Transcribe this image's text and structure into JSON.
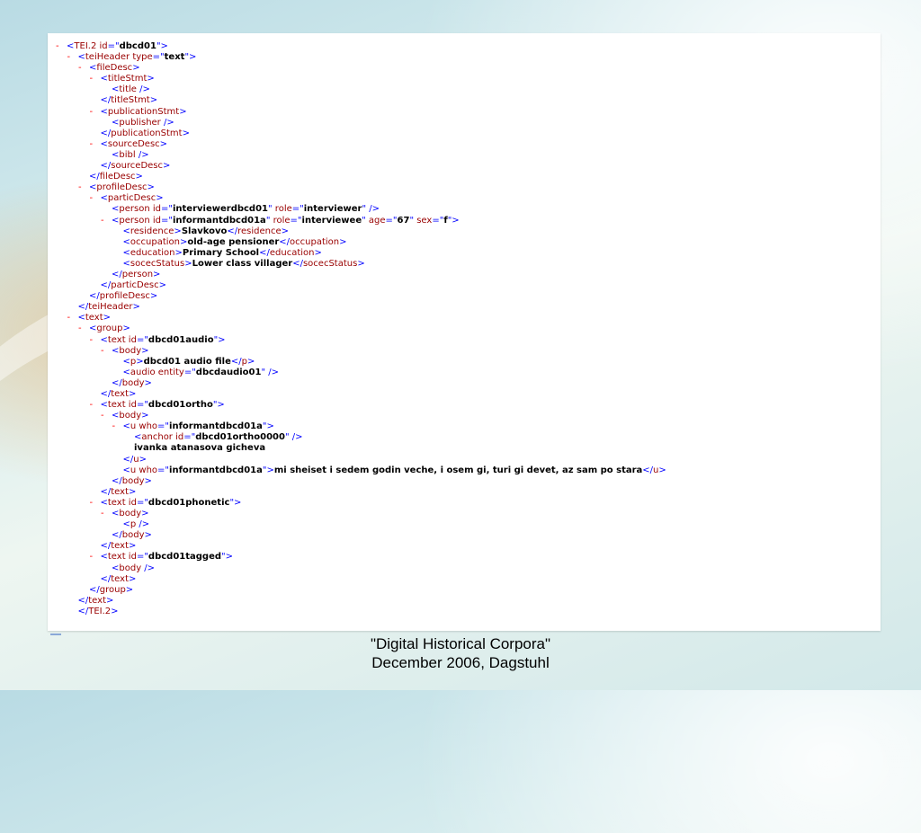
{
  "xml_lines": [
    {
      "indent": 0,
      "marker": "-",
      "html": "<span class='b'>&lt;</span><span class='t'>TEI.2 id</span><span class='b'>=\"</span><span class='v'>dbcd01</span><span class='b'>\"&gt;</span>"
    },
    {
      "indent": 1,
      "marker": "-",
      "html": "<span class='b'>&lt;</span><span class='t'>teiHeader type</span><span class='b'>=\"</span><span class='v'>text</span><span class='b'>\"&gt;</span>"
    },
    {
      "indent": 2,
      "marker": "-",
      "html": "<span class='b'>&lt;</span><span class='t'>fileDesc</span><span class='b'>&gt;</span>"
    },
    {
      "indent": 3,
      "marker": "-",
      "html": "<span class='b'>&lt;</span><span class='t'>titleStmt</span><span class='b'>&gt;</span>"
    },
    {
      "indent": 4,
      "marker": "",
      "html": "<span class='b'>&lt;</span><span class='t'>title</span><span class='b'> /&gt;</span>"
    },
    {
      "indent": 3,
      "marker": "",
      "html": "<span class='b'>&lt;/</span><span class='t'>titleStmt</span><span class='b'>&gt;</span>"
    },
    {
      "indent": 3,
      "marker": "-",
      "html": "<span class='b'>&lt;</span><span class='t'>publicationStmt</span><span class='b'>&gt;</span>"
    },
    {
      "indent": 4,
      "marker": "",
      "html": "<span class='b'>&lt;</span><span class='t'>publisher</span><span class='b'> /&gt;</span>"
    },
    {
      "indent": 3,
      "marker": "",
      "html": "<span class='b'>&lt;/</span><span class='t'>publicationStmt</span><span class='b'>&gt;</span>"
    },
    {
      "indent": 3,
      "marker": "-",
      "html": "<span class='b'>&lt;</span><span class='t'>sourceDesc</span><span class='b'>&gt;</span>"
    },
    {
      "indent": 4,
      "marker": "",
      "html": "<span class='b'>&lt;</span><span class='t'>bibl</span><span class='b'> /&gt;</span>"
    },
    {
      "indent": 3,
      "marker": "",
      "html": "<span class='b'>&lt;/</span><span class='t'>sourceDesc</span><span class='b'>&gt;</span>"
    },
    {
      "indent": 2,
      "marker": "",
      "html": "<span class='b'>&lt;/</span><span class='t'>fileDesc</span><span class='b'>&gt;</span>"
    },
    {
      "indent": 2,
      "marker": "-",
      "html": "<span class='b'>&lt;</span><span class='t'>profileDesc</span><span class='b'>&gt;</span>"
    },
    {
      "indent": 3,
      "marker": "-",
      "html": "<span class='b'>&lt;</span><span class='t'>particDesc</span><span class='b'>&gt;</span>"
    },
    {
      "indent": 4,
      "marker": "",
      "html": "<span class='b'>&lt;</span><span class='t'>person id</span><span class='b'>=\"</span><span class='v'>interviewerdbcd01</span><span class='b'>\"</span><span class='a'> role</span><span class='b'>=\"</span><span class='v'>interviewer</span><span class='b'>\" /&gt;</span>"
    },
    {
      "indent": 4,
      "marker": "-",
      "html": "<span class='b'>&lt;</span><span class='t'>person id</span><span class='b'>=\"</span><span class='v'>informantdbcd01a</span><span class='b'>\"</span><span class='a'> role</span><span class='b'>=\"</span><span class='v'>interviewee</span><span class='b'>\"</span><span class='a'> age</span><span class='b'>=\"</span><span class='v'>67</span><span class='b'>\"</span><span class='a'> sex</span><span class='b'>=\"</span><span class='v'>f</span><span class='b'>\"&gt;</span>"
    },
    {
      "indent": 5,
      "marker": "",
      "html": "<span class='b'>&lt;</span><span class='t'>residence</span><span class='b'>&gt;</span><span class='x'>Slavkovo</span><span class='b'>&lt;/</span><span class='t'>residence</span><span class='b'>&gt;</span>"
    },
    {
      "indent": 5,
      "marker": "",
      "html": "<span class='b'>&lt;</span><span class='t'>occupation</span><span class='b'>&gt;</span><span class='x'>old-age pensioner</span><span class='b'>&lt;/</span><span class='t'>occupation</span><span class='b'>&gt;</span>"
    },
    {
      "indent": 5,
      "marker": "",
      "html": "<span class='b'>&lt;</span><span class='t'>education</span><span class='b'>&gt;</span><span class='x'>Primary School</span><span class='b'>&lt;/</span><span class='t'>education</span><span class='b'>&gt;</span>"
    },
    {
      "indent": 5,
      "marker": "",
      "html": "<span class='b'>&lt;</span><span class='t'>socecStatus</span><span class='b'>&gt;</span><span class='x'>Lower class villager</span><span class='b'>&lt;/</span><span class='t'>socecStatus</span><span class='b'>&gt;</span>"
    },
    {
      "indent": 4,
      "marker": "",
      "html": "<span class='b'>&lt;/</span><span class='t'>person</span><span class='b'>&gt;</span>"
    },
    {
      "indent": 3,
      "marker": "",
      "html": "<span class='b'>&lt;/</span><span class='t'>particDesc</span><span class='b'>&gt;</span>"
    },
    {
      "indent": 2,
      "marker": "",
      "html": "<span class='b'>&lt;/</span><span class='t'>profileDesc</span><span class='b'>&gt;</span>"
    },
    {
      "indent": 1,
      "marker": "",
      "html": "<span class='b'>&lt;/</span><span class='t'>teiHeader</span><span class='b'>&gt;</span>"
    },
    {
      "indent": 1,
      "marker": "-",
      "html": "<span class='b'>&lt;</span><span class='t'>text</span><span class='b'>&gt;</span>"
    },
    {
      "indent": 2,
      "marker": "-",
      "html": "<span class='b'>&lt;</span><span class='t'>group</span><span class='b'>&gt;</span>"
    },
    {
      "indent": 3,
      "marker": "-",
      "html": "<span class='b'>&lt;</span><span class='t'>text id</span><span class='b'>=\"</span><span class='v'>dbcd01audio</span><span class='b'>\"&gt;</span>"
    },
    {
      "indent": 4,
      "marker": "-",
      "html": "<span class='b'>&lt;</span><span class='t'>body</span><span class='b'>&gt;</span>"
    },
    {
      "indent": 5,
      "marker": "",
      "html": "<span class='b'>&lt;</span><span class='t'>p</span><span class='b'>&gt;</span><span class='x'>dbcd01 audio file</span><span class='b'>&lt;/</span><span class='t'>p</span><span class='b'>&gt;</span>"
    },
    {
      "indent": 5,
      "marker": "",
      "html": "<span class='b'>&lt;</span><span class='t'>audio entity</span><span class='b'>=\"</span><span class='v'>dbcdaudio01</span><span class='b'>\" /&gt;</span>"
    },
    {
      "indent": 4,
      "marker": "",
      "html": "<span class='b'>&lt;/</span><span class='t'>body</span><span class='b'>&gt;</span>"
    },
    {
      "indent": 3,
      "marker": "",
      "html": "<span class='b'>&lt;/</span><span class='t'>text</span><span class='b'>&gt;</span>"
    },
    {
      "indent": 3,
      "marker": "-",
      "html": "<span class='b'>&lt;</span><span class='t'>text id</span><span class='b'>=\"</span><span class='v'>dbcd01ortho</span><span class='b'>\"&gt;</span>"
    },
    {
      "indent": 4,
      "marker": "-",
      "html": "<span class='b'>&lt;</span><span class='t'>body</span><span class='b'>&gt;</span>"
    },
    {
      "indent": 5,
      "marker": "-",
      "html": "<span class='b'>&lt;</span><span class='t'>u who</span><span class='b'>=\"</span><span class='v'>informantdbcd01a</span><span class='b'>\"&gt;</span>"
    },
    {
      "indent": 6,
      "marker": "",
      "html": "<span class='b'>&lt;</span><span class='t'>anchor id</span><span class='b'>=\"</span><span class='v'>dbcd01ortho0000</span><span class='b'>\" /&gt;</span>"
    },
    {
      "indent": 6,
      "marker": "",
      "html": "<span class='x'>ivanka atanasova gicheva</span>"
    },
    {
      "indent": 5,
      "marker": "",
      "html": "<span class='b'>&lt;/</span><span class='t'>u</span><span class='b'>&gt;</span>"
    },
    {
      "indent": 5,
      "marker": "",
      "html": "<span class='b'>&lt;</span><span class='t'>u who</span><span class='b'>=\"</span><span class='v'>informantdbcd01a</span><span class='b'>\"&gt;</span><span class='x'>mi sheiset i sedem godin veche, i osem gi, turi gi devet, az sam po stara</span><span class='b'>&lt;/</span><span class='t'>u</span><span class='b'>&gt;</span>"
    },
    {
      "indent": 4,
      "marker": "",
      "html": "<span class='b'>&lt;/</span><span class='t'>body</span><span class='b'>&gt;</span>"
    },
    {
      "indent": 3,
      "marker": "",
      "html": "<span class='b'>&lt;/</span><span class='t'>text</span><span class='b'>&gt;</span>"
    },
    {
      "indent": 3,
      "marker": "-",
      "html": "<span class='b'>&lt;</span><span class='t'>text id</span><span class='b'>=\"</span><span class='v'>dbcd01phonetic</span><span class='b'>\"&gt;</span>"
    },
    {
      "indent": 4,
      "marker": "-",
      "html": "<span class='b'>&lt;</span><span class='t'>body</span><span class='b'>&gt;</span>"
    },
    {
      "indent": 5,
      "marker": "",
      "html": "<span class='b'>&lt;</span><span class='t'>p</span><span class='b'> /&gt;</span>"
    },
    {
      "indent": 4,
      "marker": "",
      "html": "<span class='b'>&lt;/</span><span class='t'>body</span><span class='b'>&gt;</span>"
    },
    {
      "indent": 3,
      "marker": "",
      "html": "<span class='b'>&lt;/</span><span class='t'>text</span><span class='b'>&gt;</span>"
    },
    {
      "indent": 3,
      "marker": "-",
      "html": "<span class='b'>&lt;</span><span class='t'>text id</span><span class='b'>=\"</span><span class='v'>dbcd01tagged</span><span class='b'>\"&gt;</span>"
    },
    {
      "indent": 4,
      "marker": "",
      "html": "<span class='b'>&lt;</span><span class='t'>body</span><span class='b'> /&gt;</span>"
    },
    {
      "indent": 3,
      "marker": "",
      "html": "<span class='b'>&lt;/</span><span class='t'>text</span><span class='b'>&gt;</span>"
    },
    {
      "indent": 2,
      "marker": "",
      "html": "<span class='b'>&lt;/</span><span class='t'>group</span><span class='b'>&gt;</span>"
    },
    {
      "indent": 1,
      "marker": "",
      "html": "<span class='b'>&lt;/</span><span class='t'>text</span><span class='b'>&gt;</span>"
    },
    {
      "indent": 1,
      "marker": "",
      "html": "<span class='b'>&lt;/</span><span class='t'>TEI.2</span><span class='b'>&gt;</span>"
    }
  ],
  "footer": {
    "line1": "\"Digital Historical Corpora\"",
    "line2": "December 2006, Dagstuhl"
  }
}
